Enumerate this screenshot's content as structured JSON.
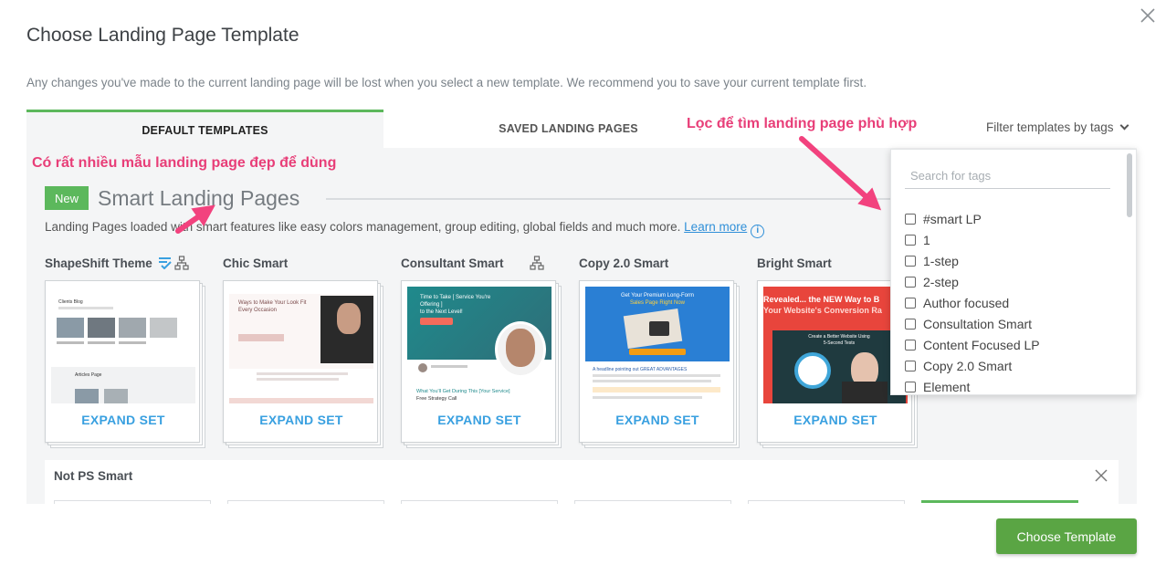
{
  "modal": {
    "title": "Choose Landing Page Template",
    "warning": "Any changes you've made to the current landing page will be lost when you select a new template. We recommend you to save your current template first."
  },
  "tabs": [
    {
      "label": "DEFAULT TEMPLATES",
      "active": true
    },
    {
      "label": "SAVED LANDING PAGES",
      "active": false
    }
  ],
  "filter": {
    "label": "Filter templates by tags",
    "search_placeholder": "Search for tags",
    "tags": [
      "#smart LP",
      "1",
      "1-step",
      "2-step",
      "Author focused",
      "Consultation Smart",
      "Content Focused LP",
      "Copy 2.0 Smart",
      "Element"
    ]
  },
  "smart_set": {
    "badge": "New",
    "title": "Smart Landing Pages",
    "description": "Landing Pages loaded with smart features like easy colors management, group editing, global fields and much more.",
    "learn_more": "Learn more",
    "info_icon": "info-icon"
  },
  "cards": [
    {
      "name": "ShapeShift Theme",
      "expand": "EXPAND SET",
      "thumb": {
        "t1": "Clients Blog",
        "t2": "Articles Page"
      }
    },
    {
      "name": "Chic Smart",
      "expand": "EXPAND SET",
      "thumb": {
        "t1": "Ways to Make Your Look Fit",
        "t2": "Every Occasion"
      }
    },
    {
      "name": "Consultant Smart",
      "expand": "EXPAND SET",
      "thumb": {
        "t1": "Time to Take [ Service You're Offering ]",
        "t2": "to the Next Level!",
        "t3": "What You'll Get During This [Your Service]",
        "t4": "Free Strategy Call"
      }
    },
    {
      "name": "Copy 2.0 Smart",
      "expand": "EXPAND SET",
      "thumb": {
        "t1": "Get Your Premium Long-Form",
        "t2": "Sales Page Right Now",
        "t3": "A headline pointing out GREAT ADVANTAGES"
      }
    },
    {
      "name": "Bright Smart",
      "expand": "EXPAND SET",
      "thumb": {
        "t1": "Revealed... the NEW Way to B",
        "t2": "Your Website's Conversion Ra",
        "t3": "Create a Better Website Using",
        "t4": "5-Second Tests"
      }
    }
  ],
  "second_set": {
    "title": "Not PS Smart"
  },
  "annotations": {
    "left": "Có rất nhiều mẫu landing page đẹp để dùng",
    "right": "Lọc để tìm landing page phù hợp"
  },
  "footer": {
    "choose_label": "Choose Template"
  },
  "colors": {
    "accent_green": "#5cb85c",
    "link_blue": "#2f8fd8",
    "annotation_pink": "#e83e78"
  }
}
